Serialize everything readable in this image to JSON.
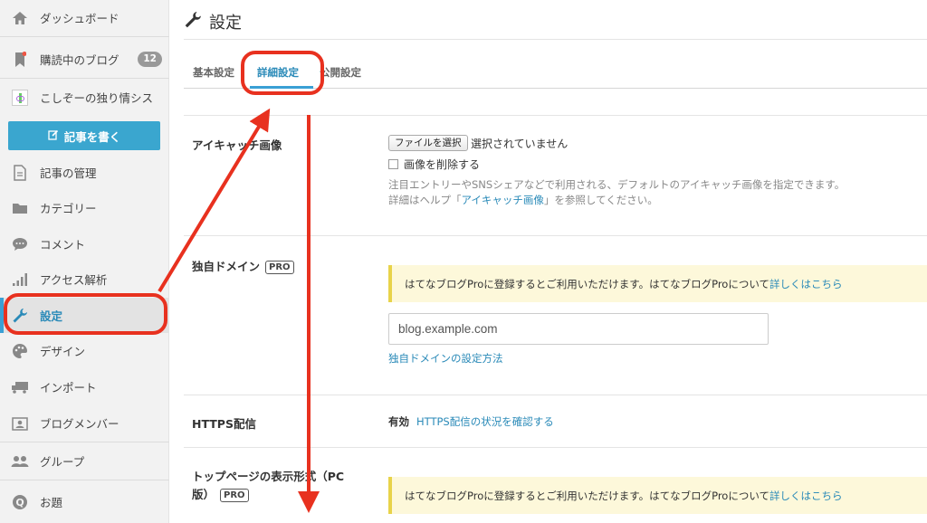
{
  "sidebar": {
    "items": [
      {
        "label": "ダッシュボード",
        "icon": "home-icon"
      },
      {
        "label": "購読中のブログ",
        "icon": "bookmark-icon",
        "badge": "12"
      },
      {
        "label": "こしぞーの独り情シス",
        "icon": "blog-thumbnail-icon"
      },
      {
        "label": "記事の管理",
        "icon": "document-icon"
      },
      {
        "label": "カテゴリー",
        "icon": "folder-icon"
      },
      {
        "label": "コメント",
        "icon": "comment-icon"
      },
      {
        "label": "アクセス解析",
        "icon": "bar-chart-icon"
      },
      {
        "label": "設定",
        "icon": "wrench-icon"
      },
      {
        "label": "デザイン",
        "icon": "palette-icon"
      },
      {
        "label": "インポート",
        "icon": "truck-icon"
      },
      {
        "label": "ブログメンバー",
        "icon": "member-card-icon"
      },
      {
        "label": "グループ",
        "icon": "group-icon"
      },
      {
        "label": "お題",
        "icon": "q-circle-icon"
      }
    ],
    "write_button": "記事を書く"
  },
  "header": {
    "title": "設定"
  },
  "tabs": [
    {
      "label": "基本設定"
    },
    {
      "label": "詳細設定",
      "active": true
    },
    {
      "label": "公開設定"
    }
  ],
  "eyecatch": {
    "label": "アイキャッチ画像",
    "file_button": "ファイルを選択",
    "file_status": "選択されていません",
    "delete_checkbox": "画像を削除する",
    "help_line1": "注目エントリーやSNSシェアなどで利用される、デフォルトのアイキャッチ画像を指定できます。",
    "help_line2_prefix": "詳細はヘルプ「",
    "help_link": "アイキャッチ画像",
    "help_line2_suffix": "」を参照してください。"
  },
  "domain": {
    "label": "独自ドメイン",
    "pro": "PRO",
    "notice_text": "はてなブログProに登録するとご利用いただけます。はてなブログProについて",
    "notice_link": "詳しくはこちら",
    "input_placeholder": "blog.example.com",
    "settings_link": "独自ドメインの設定方法"
  },
  "https": {
    "label": "HTTPS配信",
    "status": "有効",
    "link": "HTTPS配信の状況を確認する"
  },
  "toppage": {
    "label_line1": "トップページの表示形式（PC",
    "label_line2": "版）",
    "pro": "PRO",
    "notice_text": "はてなブログProに登録するとご利用いただけます。はてなブログProについて",
    "notice_link": "詳しくはこちら"
  },
  "colors": {
    "accent": "#3aa0d5",
    "annotation_red": "#e8311f",
    "notice_bg": "#fdf8da",
    "notice_border": "#e8d34a"
  }
}
